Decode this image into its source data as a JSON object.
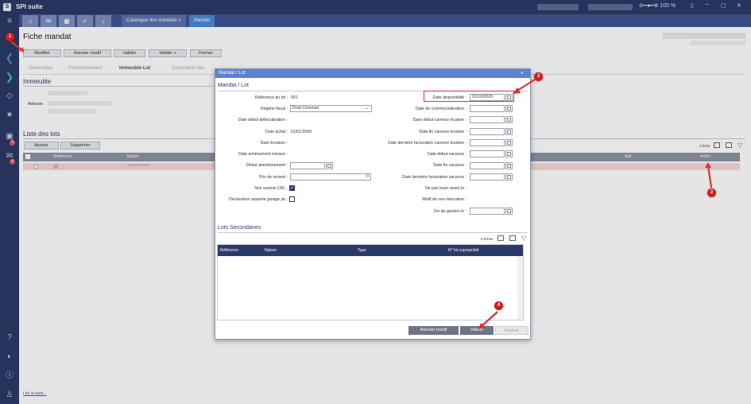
{
  "app": {
    "title": "SPI suite",
    "zoom": "100 %"
  },
  "tabs": [
    {
      "label": "Catalogue des mandats",
      "close": "×"
    },
    {
      "label": "Mandat"
    }
  ],
  "page": {
    "title": "Fiche mandat",
    "toolbar": [
      "Modifier",
      "Annuler modif",
      "Valider",
      "Valider +",
      "Fermer"
    ],
    "subtabs": [
      "Généralités",
      "Fonctionnement",
      "Immeuble-Lot",
      "Documents liés"
    ],
    "immeuble": {
      "title": "Immeuble",
      "adresse_label": "Adresse"
    },
    "lots": {
      "title": "Liste des lots",
      "buttons": [
        "Ajouter",
        "Supprimer"
      ],
      "count": "1 fiche",
      "columns": {
        "ref": "Référence",
        "nature": "Nature",
        "bail": "Bail",
        "infos": "+Infos"
      },
      "row": {
        "nature": "Appartement"
      }
    },
    "footer_link": "Lire la suite..."
  },
  "dialog": {
    "title": "Mandat / Lot",
    "close": "×",
    "section": "Mandat / Lot",
    "left": [
      {
        "label": "Référence du lot :",
        "value": "001"
      },
      {
        "label": "Régime fiscal :",
        "value": "Droit Commun"
      },
      {
        "label": "Date début défiscalisation :",
        "value": ""
      },
      {
        "label": "Date achat :",
        "value": "01/01/2000"
      },
      {
        "label": "Date livraison :",
        "value": ""
      },
      {
        "label": "Date achèvement travaux :",
        "value": ""
      },
      {
        "label": "Début amortissement :",
        "value": ""
      },
      {
        "label": "Prix de revient :",
        "value": "0"
      },
      {
        "label": "Non soumis CRL :",
        "checked": true
      },
      {
        "label": "Déclaration séparée garage pk :",
        "checked": false
      }
    ],
    "right": [
      {
        "label": "Date disponibilité :",
        "value": "01/10/2020"
      },
      {
        "label": "Date de commercialisation :",
        "value": ""
      },
      {
        "label": "Date début carence locative :",
        "value": ""
      },
      {
        "label": "Date fin carence locative :",
        "value": ""
      },
      {
        "label": "Date dernière facturation carence locative :",
        "value": ""
      },
      {
        "label": "Date début vacance :",
        "value": ""
      },
      {
        "label": "Date fin vacance :",
        "value": ""
      },
      {
        "label": "Date dernière facturation vacance :",
        "value": ""
      },
      {
        "label": "Ne pas louer avant le :",
        "value": ""
      },
      {
        "label": "Motif de non-relocation :",
        "value": ""
      },
      {
        "label": "Fin de gestion le :",
        "value": ""
      }
    ],
    "secondaires": {
      "title": "Lots Secondaires",
      "count": "0 fiches",
      "columns": [
        "Référence",
        "Nature",
        "Type",
        "N° lot copropriété"
      ]
    },
    "footer": [
      "Annuler modif",
      "Valider",
      "Fermer"
    ]
  },
  "annotations": [
    "1",
    "2",
    "3",
    "4"
  ],
  "colors": {
    "nav": "#2b3a67",
    "dialog_title": "#5b82d4",
    "marker": "#d71b1b",
    "highlight": "#e03131"
  }
}
